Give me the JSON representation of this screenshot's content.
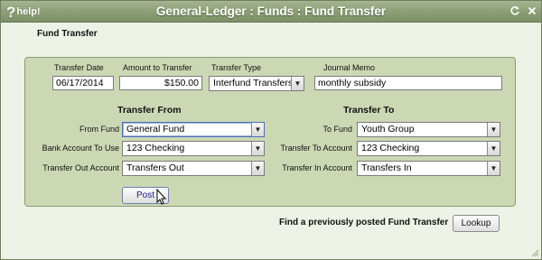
{
  "window": {
    "help_q": "?",
    "help_text": "help!",
    "title": "General-Ledger : Funds : Fund Transfer",
    "refresh_icon": "refresh-icon",
    "close_icon": "close-icon"
  },
  "section": {
    "label": "Fund Transfer"
  },
  "top_row": {
    "transfer_date_label": "Transfer Date",
    "transfer_date_value": "06/17/2014",
    "amount_label": "Amount to Transfer",
    "amount_value": "$150.00",
    "transfer_type_label": "Transfer Type",
    "transfer_type_value": "Interfund Transfers",
    "journal_memo_label": "Journal Memo",
    "journal_memo_value": "monthly subsidy"
  },
  "transfer_from": {
    "heading": "Transfer From",
    "from_fund_label": "From Fund",
    "from_fund_value": "General Fund",
    "bank_account_label": "Bank Account To Use",
    "bank_account_value": "123 Checking",
    "transfer_out_label": "Transfer Out Account",
    "transfer_out_value": "Transfers Out"
  },
  "transfer_to": {
    "heading": "Transfer To",
    "to_fund_label": "To Fund",
    "to_fund_value": "Youth Group",
    "transfer_to_account_label": "Transfer To Account",
    "transfer_to_account_value": "123 Checking",
    "transfer_in_label": "Transfer In Account",
    "transfer_in_value": "Transfers In"
  },
  "actions": {
    "post_label": "Post",
    "find_label": "Find a previously posted Fund Transfer",
    "lookup_label": "Lookup"
  },
  "colors": {
    "titlebar": "#8b9d74",
    "background": "#eef2e6",
    "panel": "#ccd8b4"
  }
}
